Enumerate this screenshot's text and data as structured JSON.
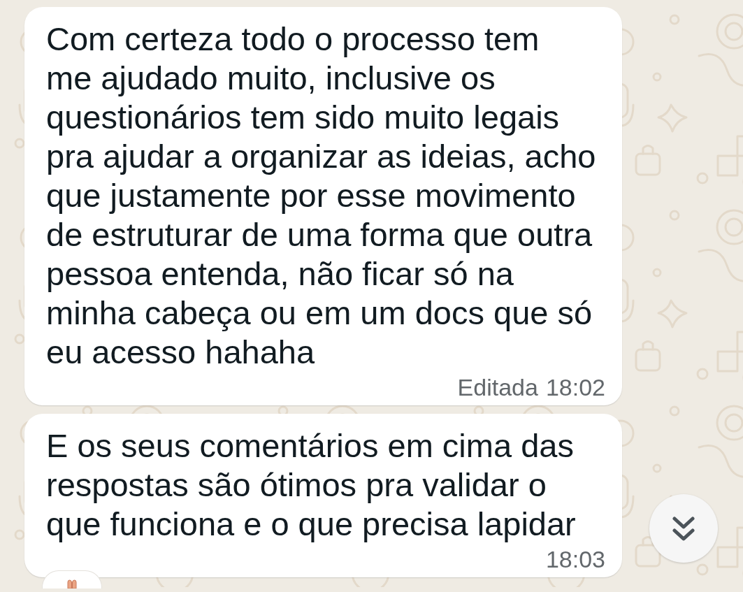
{
  "chat": {
    "messages": [
      {
        "text": "Com certeza todo o processo tem\nme ajudado muito, inclusive os\nquestionários tem sido muito legais\npra ajudar a organizar as ideias, acho\nque justamente por esse movimento\nde estruturar de uma forma que outra\npessoa entenda, não ficar só na\nminha cabeça ou em um docs que só\neu acesso hahaha",
        "edited_label": "Editada",
        "time": "18:02",
        "reacted": false
      },
      {
        "text": "E os seus comentários em cima das\nrespostas são ótimos pra validar o\nque funciona e o que precisa lapidar",
        "time": "18:03",
        "reacted": true
      }
    ]
  },
  "scroll_button": {
    "kind": "double-chevron"
  }
}
